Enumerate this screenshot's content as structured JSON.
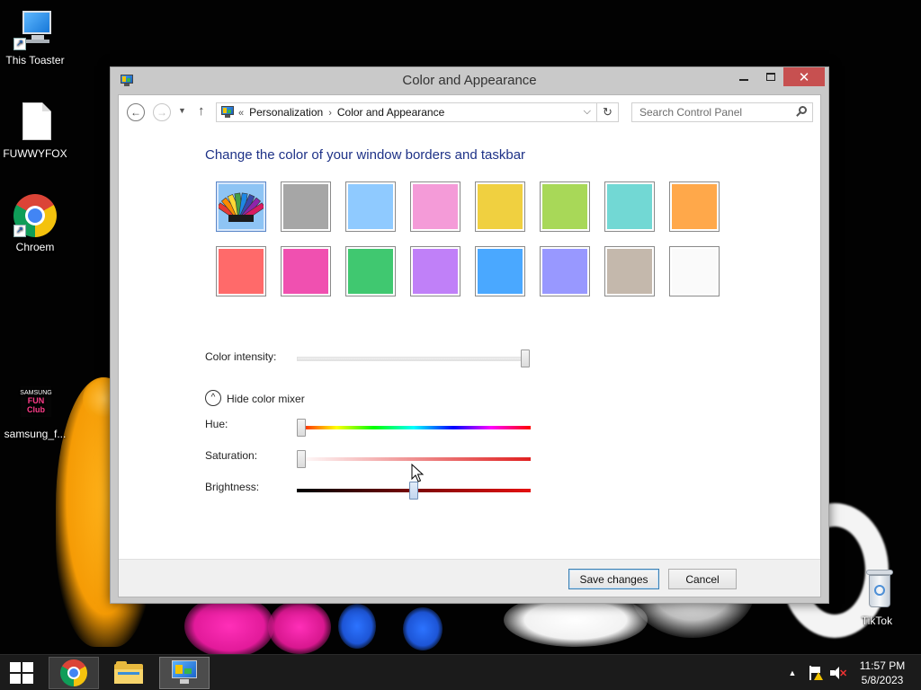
{
  "desktop": {
    "icons": [
      {
        "label": "This Toaster",
        "icon": "computer-icon"
      },
      {
        "label": "FUWWYFOX",
        "icon": "document-icon"
      },
      {
        "label": "Chroem",
        "icon": "chrome-icon"
      },
      {
        "label": "samsung_f...",
        "icon": "samsung-icon"
      },
      {
        "label": "TikTok",
        "icon": "recycle-bin-icon"
      }
    ],
    "samsung_icon_text": {
      "top": "SAMSUNG",
      "brand": "FUN Club"
    }
  },
  "window": {
    "title": "Color and Appearance",
    "close_glyph": "✕",
    "address": {
      "overflow": "«",
      "crumbs": [
        "Personalization",
        "Color and Appearance"
      ],
      "separator": "›"
    },
    "search_placeholder": "Search Control Panel"
  },
  "content": {
    "heading": "Change the color of your window borders and taskbar",
    "swatch_colors": [
      "#8ec4f4",
      "#a6a6a6",
      "#8fcaff",
      "#f49bd8",
      "#f0d040",
      "#a8d858",
      "#72d8d4",
      "#ffa84a",
      "#ff6a6a",
      "#f050b0",
      "#40c870",
      "#c080f8",
      "#4aa8ff",
      "#9898ff",
      "#c4b8ac",
      "#fafafa"
    ],
    "selected_swatch": 0,
    "color_intensity": {
      "label": "Color intensity:",
      "value": 1.0
    },
    "mixer_toggle": {
      "glyph": "^",
      "label": "Hide color mixer"
    },
    "hue": {
      "label": "Hue:",
      "value": 0.0
    },
    "saturation": {
      "label": "Saturation:",
      "value": 0.0
    },
    "brightness": {
      "label": "Brightness:",
      "value": 0.5
    }
  },
  "footer": {
    "save_label": "Save changes",
    "cancel_label": "Cancel"
  },
  "taskbar": {
    "apps": [
      "chrome-icon",
      "file-explorer-icon",
      "control-panel-icon"
    ],
    "tray_up_glyph": "▲",
    "time": "11:57 PM",
    "date": "5/8/2023"
  }
}
